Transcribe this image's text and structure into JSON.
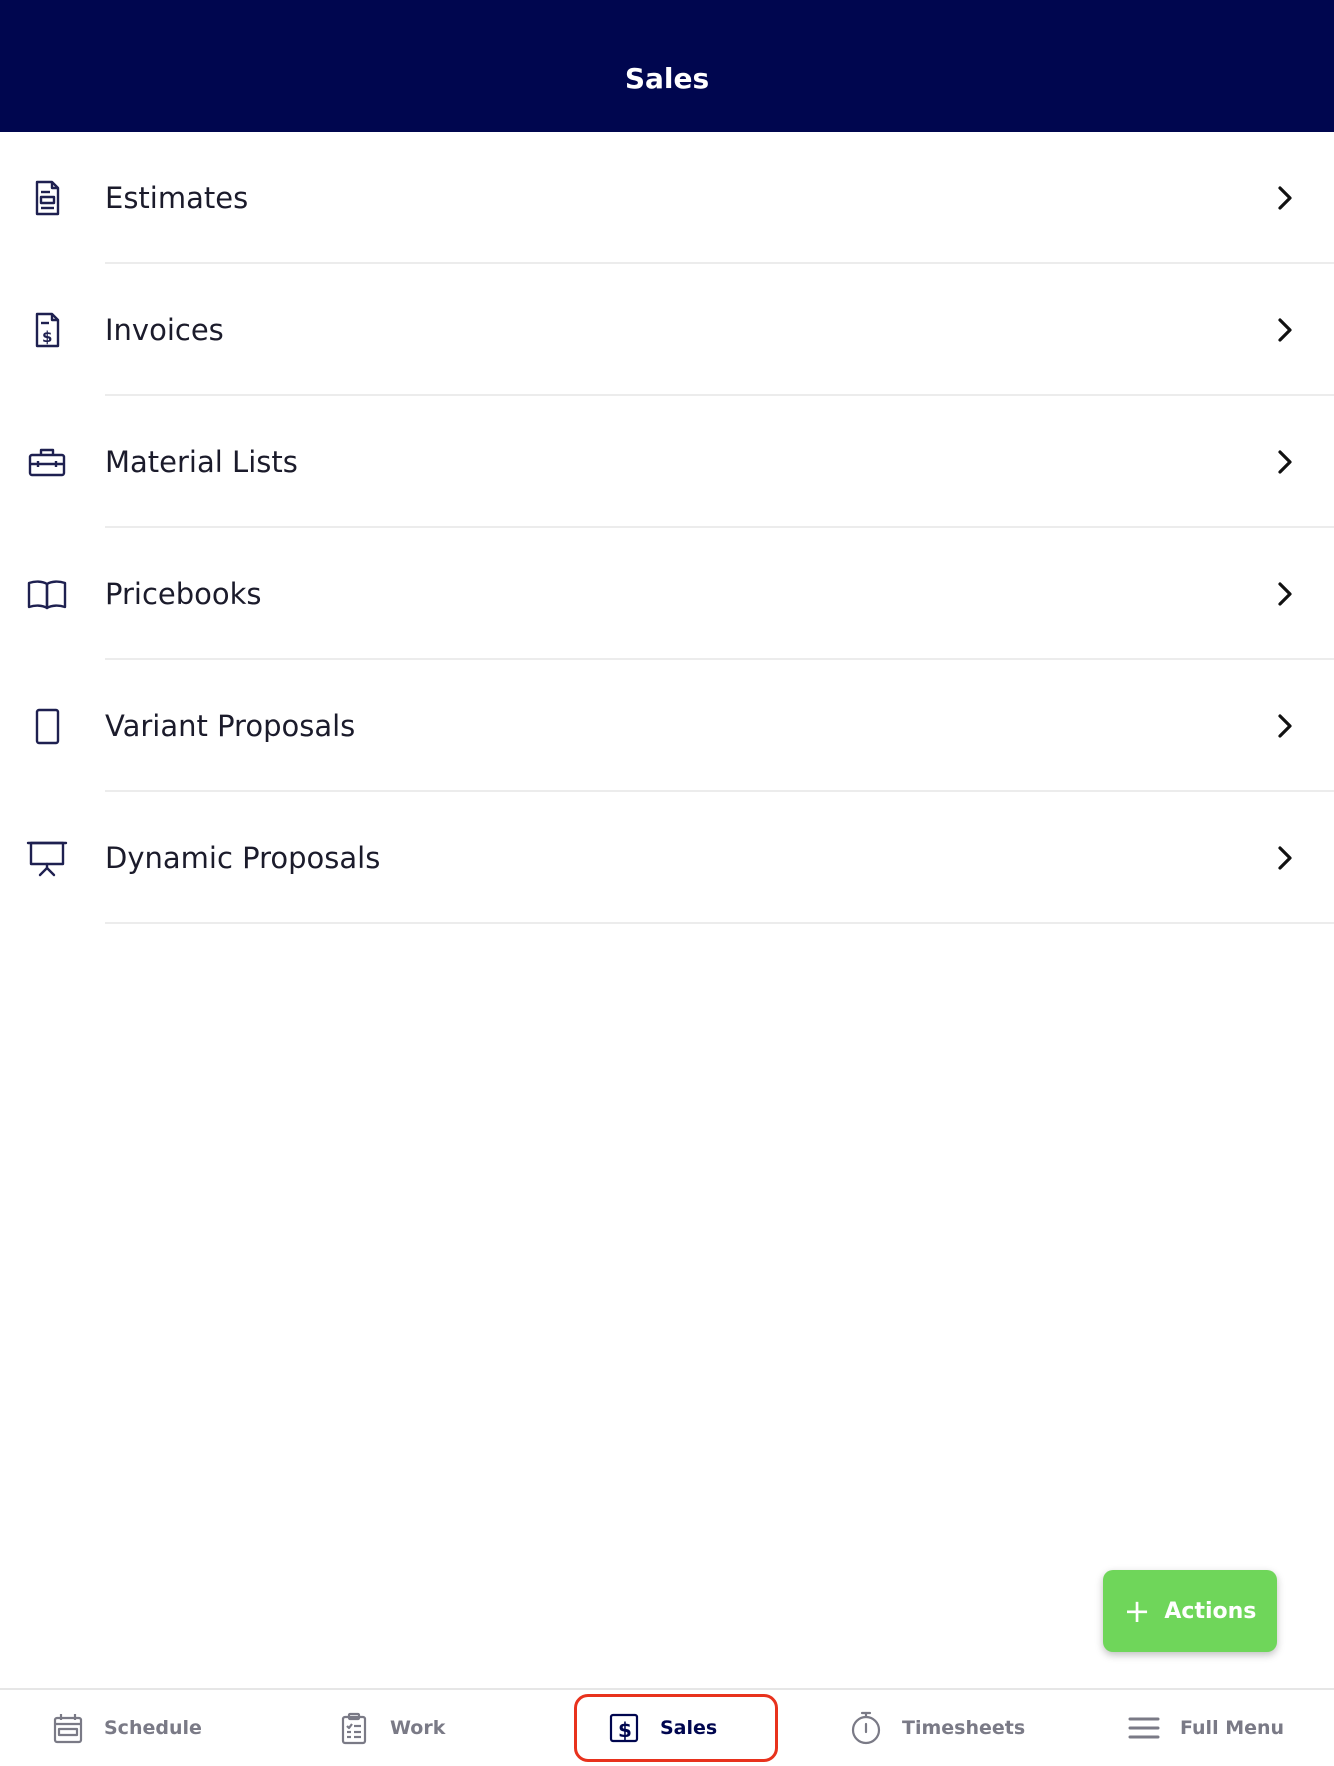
{
  "header": {
    "title": "Sales"
  },
  "menu": [
    {
      "label": "Estimates",
      "icon": "estimate-document-icon"
    },
    {
      "label": "Invoices",
      "icon": "invoice-dollar-icon"
    },
    {
      "label": "Material Lists",
      "icon": "toolbox-icon"
    },
    {
      "label": "Pricebooks",
      "icon": "open-book-icon"
    },
    {
      "label": "Variant Proposals",
      "icon": "tablet-icon"
    },
    {
      "label": "Dynamic Proposals",
      "icon": "presentation-board-icon"
    }
  ],
  "fab": {
    "label": "Actions",
    "icon": "plus-icon",
    "color": "#6fd65a"
  },
  "nav": [
    {
      "label": "Schedule",
      "icon": "calendar-icon"
    },
    {
      "label": "Work",
      "icon": "clipboard-icon"
    },
    {
      "label": "Sales",
      "icon": "dollar-icon",
      "active": true
    },
    {
      "label": "Timesheets",
      "icon": "stopwatch-icon"
    },
    {
      "label": "Full Menu",
      "icon": "hamburger-menu-icon"
    }
  ],
  "colors": {
    "header_bg": "#00064f",
    "active_nav": "#00064f",
    "highlight_outline": "#e8321d"
  }
}
